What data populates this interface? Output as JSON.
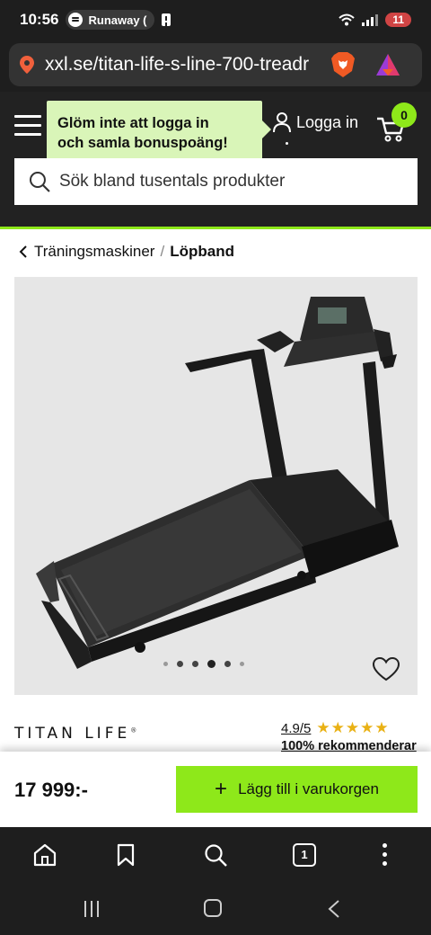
{
  "status_bar": {
    "time": "10:56",
    "media_label": "Runaway (",
    "battery": "11"
  },
  "browser": {
    "url": "xxl.se/titan-life-s-line-700-treadr"
  },
  "header": {
    "tooltip_line1": "Glöm inte att logga in",
    "tooltip_line2": "och samla bonuspoäng!",
    "login_label": "Logga in",
    "cart_count": "0",
    "search_placeholder": "Sök bland tusentals produkter"
  },
  "breadcrumb": {
    "parent": "Träningsmaskiner",
    "separator": "/",
    "current": "Löpband"
  },
  "product": {
    "brand": "TITAN LIFE",
    "brand_mark": "®",
    "rating": "4.9/5",
    "stars": "★★★★★",
    "recommend": "100% rekommenderar",
    "price": "17 999:-",
    "add_to_cart": "Lägg till i varukorgen",
    "carousel_count": 6,
    "carousel_active": 3
  },
  "toolbar": {
    "tab_count": "1"
  },
  "colors": {
    "accent": "#8ee81a",
    "header_bg": "#222222",
    "tooltip_bg": "#d9f5b8",
    "star": "#e9b114"
  }
}
